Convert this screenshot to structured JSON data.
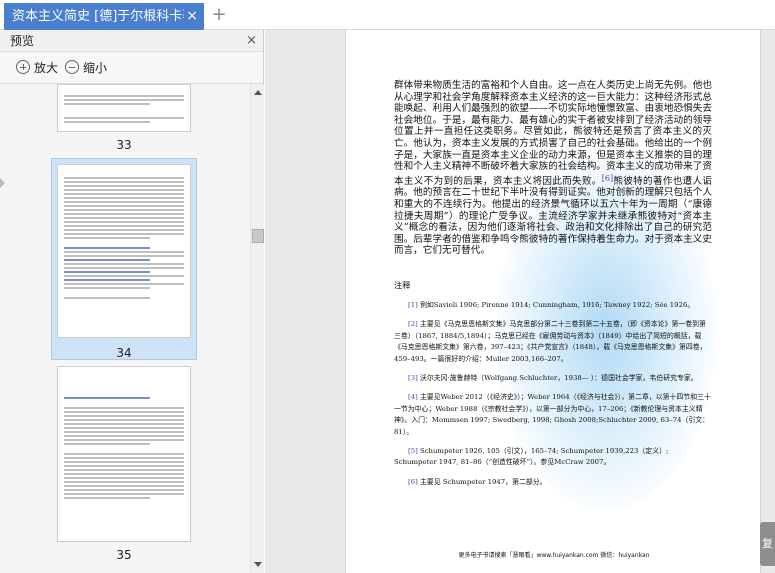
{
  "tab": {
    "title": "资本主义简史 [德]于尔根科卡著",
    "close": "×",
    "add": "+"
  },
  "preview": {
    "title": "预览",
    "close": "×",
    "zoom_in": "放大",
    "zoom_out": "缩小",
    "pages": [
      {
        "number": "33"
      },
      {
        "number": "34",
        "selected": true
      },
      {
        "number": "35"
      }
    ]
  },
  "document": {
    "paragraph": [
      "群体带来物质生活的富裕和个人自由。这一点在人类历史上尚无先例。他也从心理学和社会学角度解释资本主义经济的这一巨大能力：这种经济形式总能唤起、利用人们最强烈的欲望——不切实际地憧憬致富、由衷地恐惧失去社会地位。于是，最有能力、最有雄心的实干者被安排到了经济活动的领导位置上并一直担任这类职务。尽管如此，熊彼特还是预言了资本主义的灭亡。他认为，资本主义发展的方式损害了自己的社会基础。他给出的一个例子是，大家族一直是资本主义企业的动力来源，但是资本主义推崇的目的理性和个人主义精神不断破坏着大家族的社会结构。资本主义的成功带来了资本主义不为到的后果，资本主义将因此而失败。",
      "[6]",
      "熊彼特的著作也遭人诟病。他的预言在二十世纪下半叶没有得到证实。他对创新的理解只包括个人和重大的不连续行为。他提出的经济景气循环以五六十年为一周期（“康德拉捷夫周期”）的理论广受争议。主流经济学家并未继承熊彼特对“资本主义”概念的看法，因为他们逐渐将社会、政治和文化排除出了自己的研究范围。后辈学者的借鉴和争鸣令熊彼特的著作保持着生命力。对于资本主义史而言，它们无可替代。"
    ],
    "notes_title": "注释",
    "notes": [
      {
        "num": "[1]",
        "text": "例如Savioli 1906; Pirenne 1914; Cunningham, 1916; Tawney 1922; Sée 1926。"
      },
      {
        "num": "[2]",
        "text": "主要见《马克思恩格斯文集》马克思部分第二十三卷到第二十五卷，（即《资本论》第一卷到第三卷）（1867, 1884/5,1894）；马克思已经在《雇佣劳动与资本》（1849）中给出了简短的概括，载《马克思恩格斯文集》第六卷，397–423；《共产党宣言》（1848），载《马克思恩格斯文集》第四卷，459–493。一篇很好的介绍：Muller 2003,166–207。"
      },
      {
        "num": "[3]",
        "text": "沃尔夫冈·施鲁赫特（Wolfgang Schluchter，1938— ）：德国社会学家，韦伯研究专家。"
      },
      {
        "num": "[4]",
        "text": "主要见Weber 2012（《经济史》）；Weber 1964（《经济与社会》），第二章，以第十四节和三十一节为中心；Weber 1988（《宗教社会学》），以第一部分为中心，17–206；《新教伦理与资本主义精神》。入门：Mommsen 1997; Swedberg, 1998; Ghosh 2008;Schluchter 2009, 63–74（引文：81）。"
      },
      {
        "num": "[5]",
        "text": "Schumpeter 1926, 105（引文），165–74; Schumpeter 1939,223（定义）; Schumpeter 1947, 81–86（“创造性破坏”）。参见McCraw 2007。"
      },
      {
        "num": "[6]",
        "text": "主要见 Schumpeter 1947，第二部分。"
      }
    ],
    "footer": "更多电子书请搜索「慧眼看」www.huiyankan.com 微信：huiyankan"
  },
  "side_tag": "复"
}
